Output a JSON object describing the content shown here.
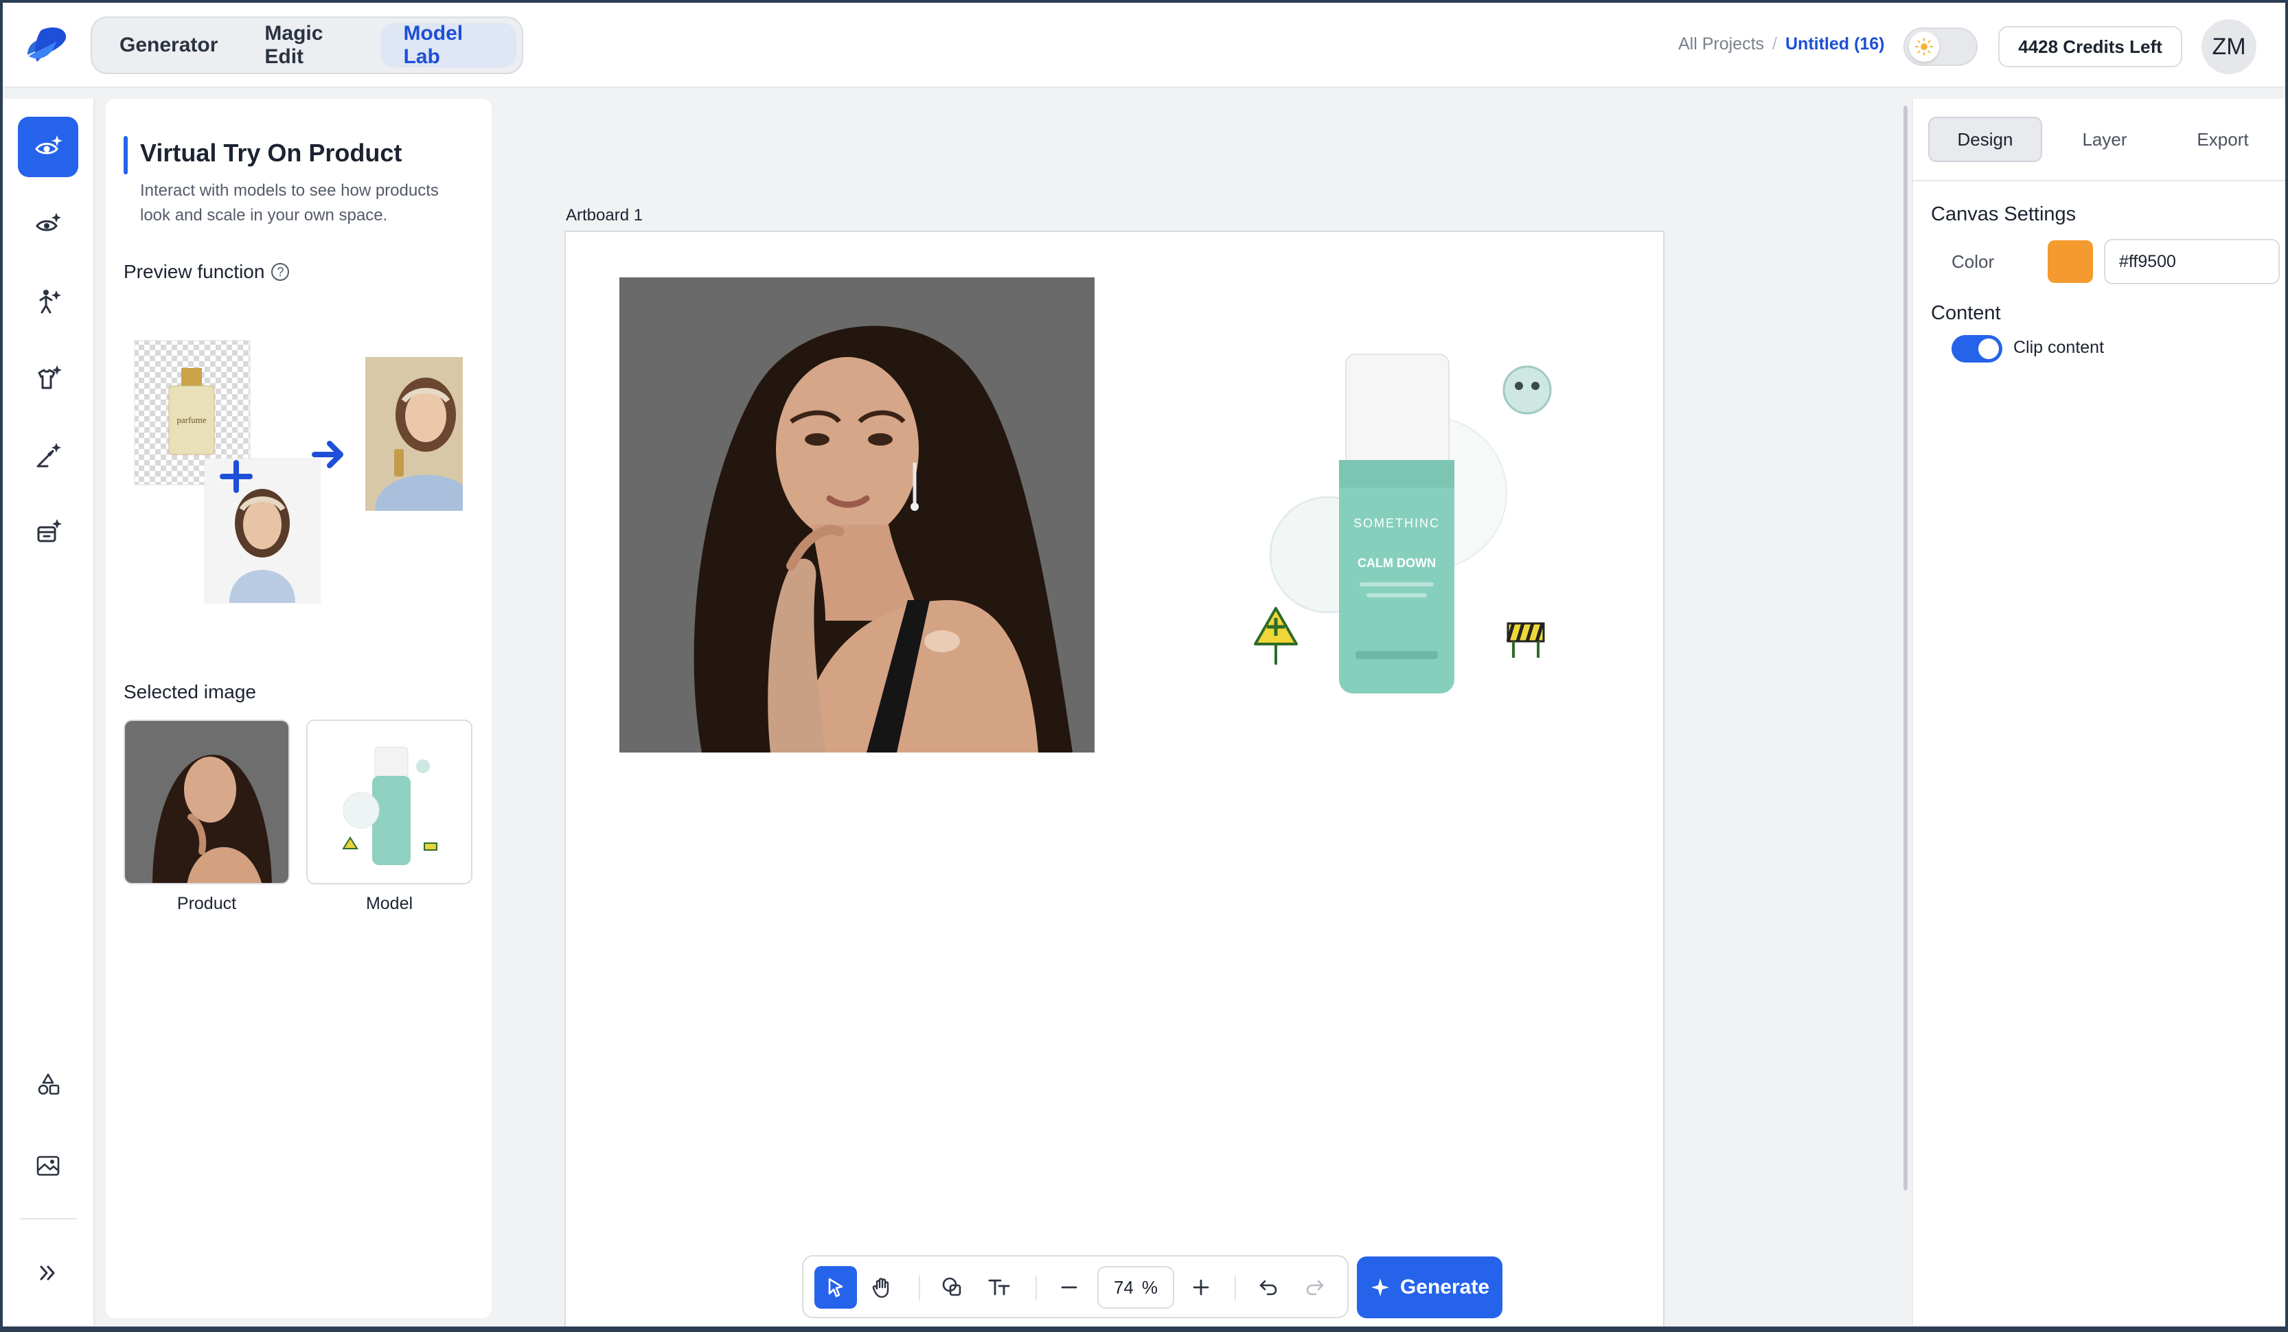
{
  "header": {
    "mode_tabs": [
      {
        "label": "Generator",
        "active": false
      },
      {
        "label": "Magic Edit",
        "active": false
      },
      {
        "label": "Model Lab",
        "active": true
      }
    ],
    "breadcrumb": {
      "root": "All Projects",
      "separator": "/",
      "current": "Untitled (16)"
    },
    "credits": "4428 Credits Left",
    "avatar_initials": "ZM"
  },
  "rail": {
    "items": [
      {
        "icon": "eye-sparkle-icon",
        "active": true
      },
      {
        "icon": "eye-spark-icon",
        "active": false
      },
      {
        "icon": "person-sparkle-icon",
        "active": false
      },
      {
        "icon": "shirt-sparkle-icon",
        "active": false
      },
      {
        "icon": "brush-sparkle-icon",
        "active": false
      },
      {
        "icon": "box-sparkle-icon",
        "active": false
      }
    ],
    "bottom_items": [
      {
        "icon": "shapes-icon"
      },
      {
        "icon": "gallery-icon"
      }
    ],
    "expand_icon": "double-chevron-right-icon"
  },
  "tool_panel": {
    "title": "Virtual Try On Product",
    "description": "Interact with models to see how products look and scale in your own space.",
    "preview_label": "Preview function",
    "preview_bottle_text": "parfume",
    "selected_label": "Selected image",
    "selected": [
      {
        "caption": "Product"
      },
      {
        "caption": "Model"
      }
    ]
  },
  "canvas": {
    "artboard_label": "Artboard 1",
    "product_brand": "SOMETHINC",
    "product_name": "CALM DOWN"
  },
  "toolbar": {
    "zoom_value": "74",
    "zoom_unit": "%",
    "generate_label": "Generate"
  },
  "right_panel": {
    "tabs": [
      {
        "label": "Design",
        "active": true
      },
      {
        "label": "Layer",
        "active": false
      },
      {
        "label": "Export",
        "active": false
      }
    ],
    "canvas_settings_title": "Canvas Settings",
    "color_label": "Color",
    "color_value": "#ff9500",
    "content_title": "Content",
    "clip_content_label": "Clip content",
    "clip_content_on": true
  },
  "colors": {
    "accent": "#2563eb",
    "swatch_display": "#f59a2e"
  }
}
